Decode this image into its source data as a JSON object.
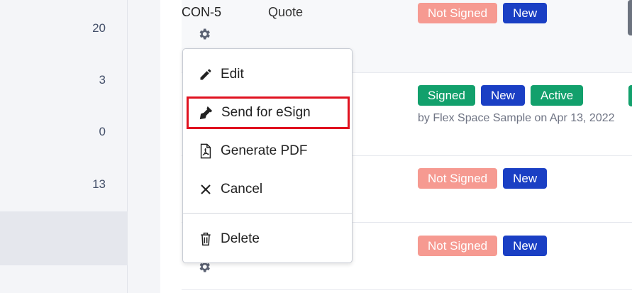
{
  "left_panel": {
    "counts": [
      "20",
      "3",
      "0",
      "13"
    ]
  },
  "rows": [
    {
      "id": "CON-5",
      "type": "Quote",
      "badges": [
        "Not Signed",
        "New"
      ]
    },
    {
      "badges": [
        "Signed",
        "New",
        "Active"
      ],
      "sub_text": "by Flex Space Sample on Apr 13, 2022"
    },
    {
      "badges": [
        "Not Signed",
        "New"
      ]
    },
    {
      "badges": [
        "Not Signed",
        "New"
      ]
    }
  ],
  "menu": {
    "items": [
      {
        "label": "Edit",
        "icon": "pencil-icon"
      },
      {
        "label": "Send for eSign",
        "icon": "pen-nib-icon",
        "highlighted": true
      },
      {
        "label": "Generate PDF",
        "icon": "pdf-file-icon"
      },
      {
        "label": "Cancel",
        "icon": "x-icon"
      },
      {
        "label": "Delete",
        "icon": "trash-icon"
      }
    ]
  },
  "colors": {
    "not_signed": "#f69a91",
    "new": "#1a3fc4",
    "signed": "#12a06c",
    "active": "#12a06c",
    "highlight_outline": "#e0121f"
  }
}
